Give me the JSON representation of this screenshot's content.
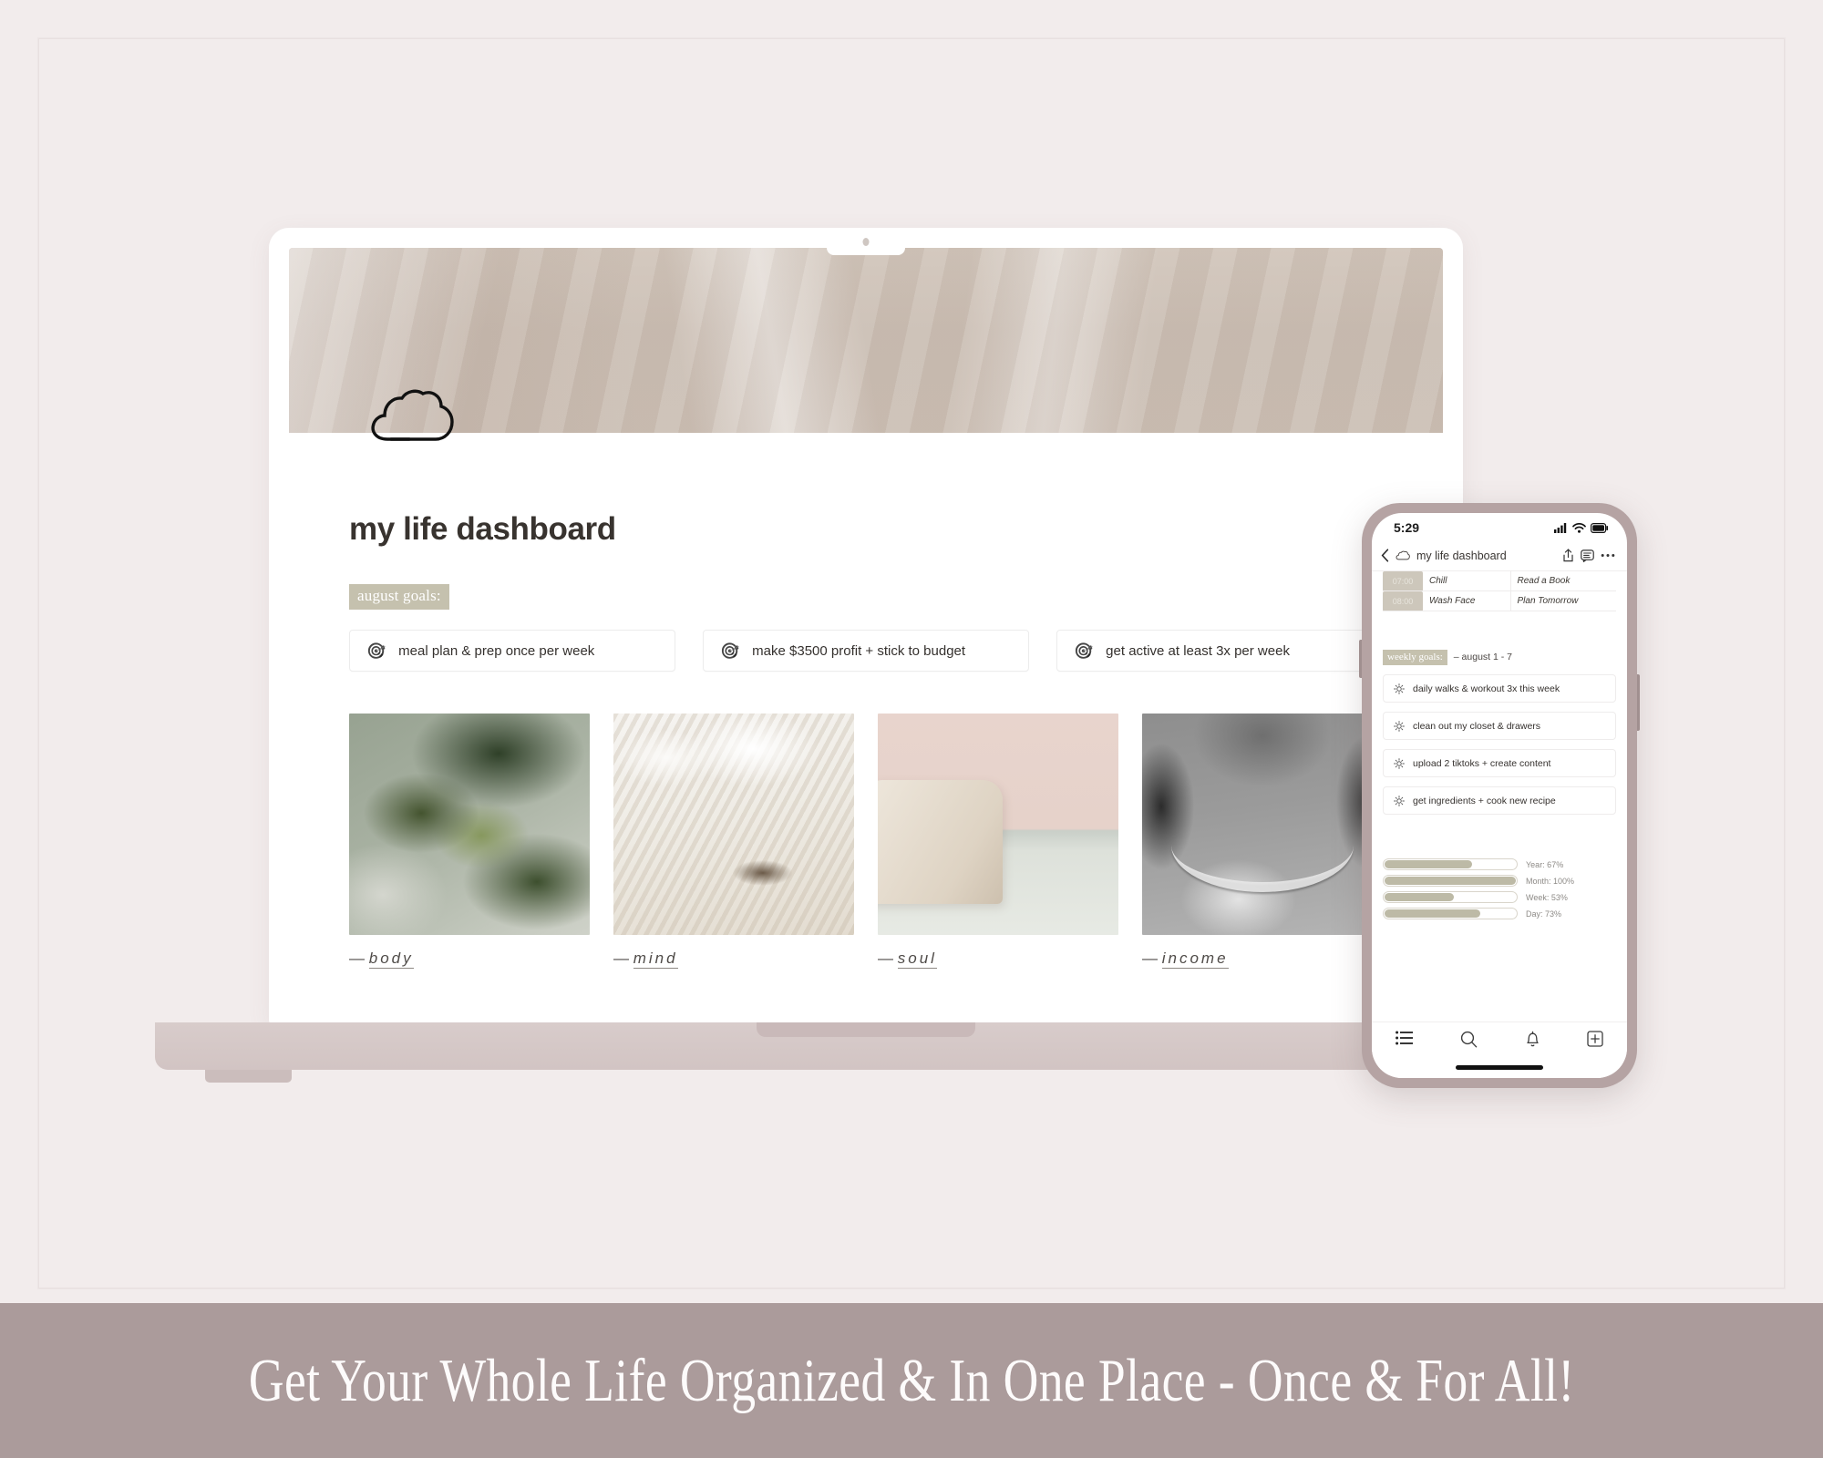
{
  "theme": {
    "background": "#f2ecec",
    "banner_bg": "#ab9b9b",
    "badge_bg": "#c5c1ae",
    "device_frame": "#b5a3a3",
    "progress_fill": "#bdbaa6"
  },
  "laptop": {
    "device_name": "laptop-mockup",
    "page": {
      "cover_name": "notion-cover-image",
      "page_icon": "cloud-icon",
      "title": "my life dashboard",
      "section_badge": "august goals:",
      "goals": [
        {
          "icon": "dart-icon",
          "emoji": "🎯",
          "text": "meal plan & prep once per week"
        },
        {
          "icon": "dart-icon",
          "emoji": "🎯",
          "text": "make $3500 profit + stick to budget"
        },
        {
          "icon": "dart-icon",
          "emoji": "🎯",
          "text": "get active at least 3x per week"
        }
      ],
      "photo_cards": [
        {
          "photo_name": "photo-pear-tree",
          "caption_dash": "—",
          "caption": "body"
        },
        {
          "photo_name": "photo-bed-book-glasses",
          "caption_dash": "—",
          "caption": "mind"
        },
        {
          "photo_name": "photo-tote-bag",
          "caption_dash": "—",
          "caption": "soul"
        },
        {
          "photo_name": "photo-chain-necklace",
          "caption_dash": "—",
          "caption": "income"
        }
      ]
    }
  },
  "phone": {
    "device_name": "phone-mockup",
    "status_bar": {
      "time": "5:29",
      "icons": [
        "cellular-signal-icon",
        "wifi-icon",
        "battery-icon"
      ]
    },
    "top_bar": {
      "back_icon": "chevron-left-icon",
      "page_icon": "cloud-icon",
      "title": "my life dashboard",
      "actions": [
        "share-icon",
        "comment-icon",
        "more-options-icon"
      ]
    },
    "schedule_table": {
      "rows": [
        {
          "time": "07:00",
          "col2": "Chill",
          "col3": "Read a Book"
        },
        {
          "time": "08:00",
          "col2": "Wash Face",
          "col3": "Plan Tomorrow"
        }
      ]
    },
    "weekly": {
      "badge": "weekly goals:",
      "range": "– august 1 - 7",
      "items": [
        {
          "icon": "sun-icon",
          "text": "daily walks & workout 3x this week"
        },
        {
          "icon": "sun-icon",
          "text": "clean out my closet & drawers"
        },
        {
          "icon": "sun-icon",
          "text": "upload 2 tiktoks + create content"
        },
        {
          "icon": "sun-icon",
          "text": "get ingredients + cook new recipe"
        }
      ]
    },
    "progress": [
      {
        "label": "Year: 67%",
        "value": 67
      },
      {
        "label": "Month: 100%",
        "value": 100
      },
      {
        "label": "Week: 53%",
        "value": 53
      },
      {
        "label": "Day: 73%",
        "value": 73
      }
    ],
    "nav": [
      {
        "icon": "list-icon",
        "name": "nav-list"
      },
      {
        "icon": "search-icon",
        "name": "nav-search"
      },
      {
        "icon": "bell-icon",
        "name": "nav-notifications"
      },
      {
        "icon": "plus-box-icon",
        "name": "nav-new"
      }
    ]
  },
  "banner": {
    "text": "Get Your Whole Life Organized & In One Place - Once & For All!"
  }
}
